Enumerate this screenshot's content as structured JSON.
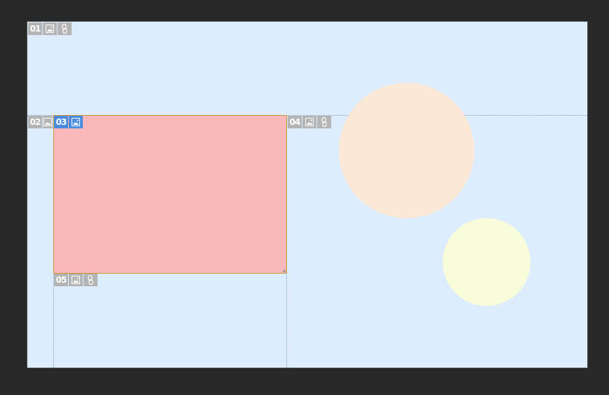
{
  "canvas": {
    "background": "#282828",
    "artboard_color": "#deedfd"
  },
  "shapes": [
    {
      "name": "peach-circle",
      "color": "#fbe8d6"
    },
    {
      "name": "yellow-circle",
      "color": "#f8fcd8"
    }
  ],
  "slices": [
    {
      "id": "01",
      "label": "01",
      "active": false,
      "icons": [
        "image-icon",
        "link-icon"
      ]
    },
    {
      "id": "02",
      "label": "02",
      "active": false,
      "icons": [
        "image-icon"
      ]
    },
    {
      "id": "03",
      "label": "03",
      "active": true,
      "icons": [
        "image-icon"
      ],
      "fill": "#f9b8b9"
    },
    {
      "id": "04",
      "label": "04",
      "active": false,
      "icons": [
        "image-icon",
        "link-icon"
      ]
    },
    {
      "id": "05",
      "label": "05",
      "active": false,
      "icons": [
        "image-icon",
        "link-icon"
      ]
    }
  ],
  "colors": {
    "badge_inactive": "#b4b4b4",
    "badge_active": "#4a8de0",
    "slice_border": "#c8932e",
    "guide_line": "#7ea4cf"
  }
}
